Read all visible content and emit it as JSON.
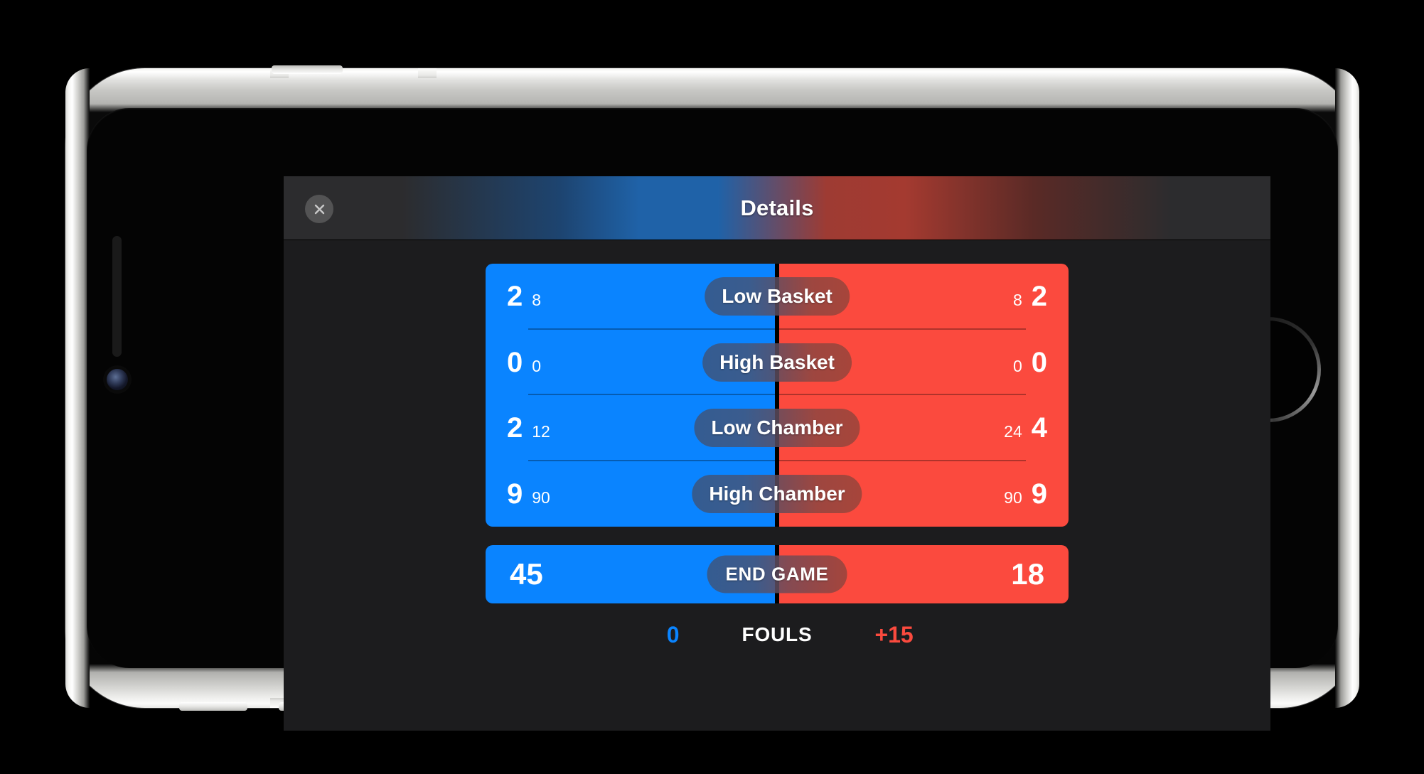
{
  "app": {
    "nav": {
      "title": "Details",
      "close_icon": "close-icon"
    }
  },
  "colors": {
    "blue": "#0a84ff",
    "red": "#fb4a3e",
    "screen_background": "#1c1c1e",
    "nav_background": "#2c2c2e"
  },
  "scoring": {
    "rows": [
      {
        "label": "Low Basket",
        "blue_count": "2",
        "blue_points": "8",
        "red_points": "8",
        "red_count": "2"
      },
      {
        "label": "High Basket",
        "blue_count": "0",
        "blue_points": "0",
        "red_points": "0",
        "red_count": "0"
      },
      {
        "label": "Low Chamber",
        "blue_count": "2",
        "blue_points": "12",
        "red_points": "24",
        "red_count": "4"
      },
      {
        "label": "High Chamber",
        "blue_count": "9",
        "blue_points": "90",
        "red_points": "90",
        "red_count": "9"
      }
    ]
  },
  "endgame": {
    "label": "END GAME",
    "blue_total": "45",
    "red_total": "18"
  },
  "fouls": {
    "label": "FOULS",
    "blue_value": "0",
    "red_value": "+15"
  }
}
